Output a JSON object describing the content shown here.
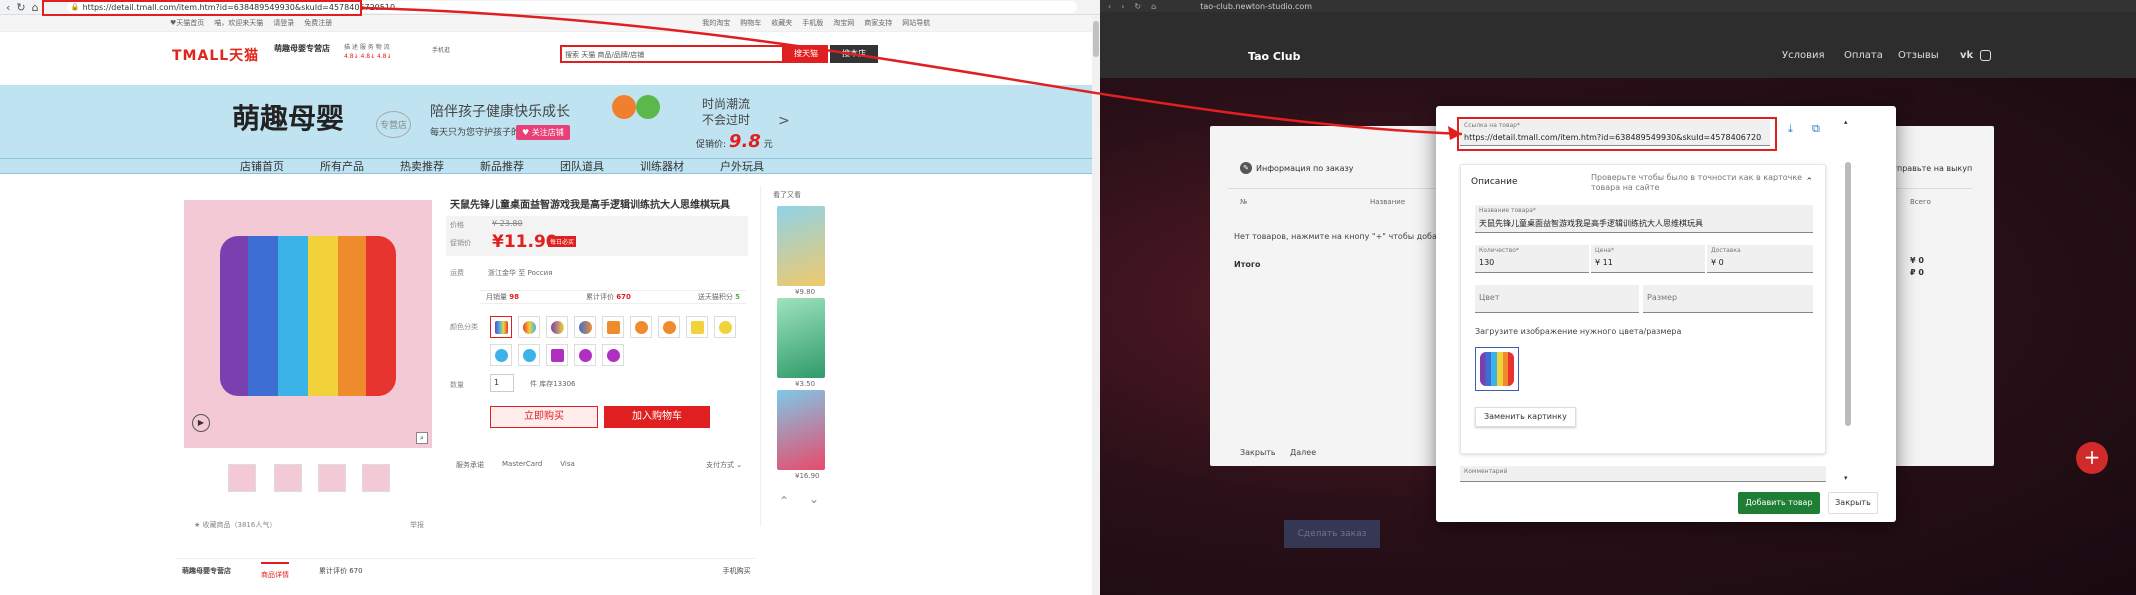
{
  "left": {
    "url": "https://detail.tmall.com/item.htm?id=638489549930&skuId=4578406720510",
    "topbar": {
      "links": [
        "♥天猫首页",
        "喵，欢迎来天猫",
        "请登录",
        "免费注册"
      ],
      "right_links": [
        "我的淘宝",
        "购物车",
        "收藏夹",
        "手机版",
        "淘宝网",
        "商家支持",
        "网站导航"
      ]
    },
    "header": {
      "logo": "TMALL天猫",
      "shop_name": "萌趣母婴专营店",
      "ratings_head": "描 述  服 务  物 流",
      "ratings_vals": "4.8↓  4.8↓  4.8↓",
      "mobile_label": "手机逛",
      "search_placeholder": "搜索 天猫 商品/品牌/店铺",
      "search_tmall_btn": "搜天猫",
      "search_shop_btn": "搜本店"
    },
    "banner": {
      "shop_title": "萌趣母婴",
      "shop_sub": "专营店",
      "slogan": "陪伴孩子健康快乐成长",
      "sub_slogan": "每天只为您守护孩子的健康",
      "follow_btn": "♥ 关注店铺",
      "trend1": "时尚潮流",
      "trend2": "不会过时",
      "promo_label": "促销价:",
      "promo_price": "9.8",
      "promo_unit": "元",
      "arrow": ">"
    },
    "nav": [
      "店铺首页",
      "所有产品",
      "热卖推荐",
      "新品推荐",
      "团队道具",
      "训练器材",
      "户外玩具"
    ],
    "product": {
      "title": "天鼠先锋儿童桌面益智游戏我是高手逻辑训练抗大人思维棋玩具",
      "price_label": "价格",
      "orig_price": "¥ 23.80",
      "promo_label": "促销价",
      "promo_price": "¥11.90",
      "promo_tag": "每日必买",
      "ship_label": "运费",
      "ship_value": "浙江金华  至 Россия",
      "monthly_label": "月销量",
      "monthly_value": "98",
      "reviews_label": "累计评价",
      "reviews_value": "670",
      "points_label": "送天猫积分",
      "points_value": "5",
      "color_label": "颜色分类",
      "qty_label": "数量",
      "qty_value": "1",
      "stock": "件   库存13306",
      "buy_now": "立即购买",
      "add_cart": "加入购物车",
      "pay_label": "服务承诺",
      "pay_methods": [
        "MasterCard",
        "Visa"
      ],
      "installment": "支付方式 ⌄",
      "favorite": "★ 收藏商品（3816人气）",
      "report": "举报"
    },
    "side": {
      "heading": "看了又看",
      "prices": [
        "¥9.80",
        "¥3.50",
        "¥16.90"
      ]
    },
    "bottom": {
      "shop": "萌趣母婴专营店",
      "tab_active": "商品详情",
      "tab_reviews": "累计评价  670",
      "phone": "手机购买"
    }
  },
  "right": {
    "url": "tao-club.newton-studio.com",
    "brand": "Tao Club",
    "nav": [
      "Условия",
      "Оплата",
      "Отзывы"
    ],
    "card": {
      "step1": "Информация по заказу",
      "step4": "Отправьте на выкуп",
      "col_no": "№",
      "col_name": "Название",
      "col_total": "Всего",
      "empty": "Нет товаров, нажмите на кнопу \"+\" чтобы добавить",
      "total_label": "Итого",
      "amt1": "¥ 0",
      "amt2": "₽ 0",
      "btn_close": "Закрыть",
      "btn_next": "Далее"
    },
    "make_order": "Сделать заказ",
    "modal": {
      "link_label": "Ссылка на товар*",
      "link_value": "https://detail.tmall.com/item.htm?id=638489549930&skuId=4578406720510",
      "section_title": "Описание",
      "section_desc": "Проверьте чтобы было в точности как в карточке товара на сайте",
      "name_label": "Название товара*",
      "name_value": "天鼠先锋儿童桌面益智游戏我是高手逻辑训练抗大人思维棋玩具",
      "qty_label": "Количество*",
      "qty_value": "130",
      "price_label": "Цена*",
      "price_value": "¥ 11",
      "delivery_label": "Доставка",
      "delivery_value": "¥ 0",
      "color_placeholder": "Цвет",
      "size_placeholder": "Размер",
      "upload_label": "Загрузите изображение нужного цвета/размера",
      "replace_btn": "Заменить картинку",
      "comment_label": "Комментарий",
      "add_btn": "Добавить товар",
      "close_btn": "Закрыть"
    }
  },
  "colors": {
    "tmall_red": "#e02020",
    "banner_blue": "#bfe3f1",
    "green": "#1e7e34",
    "fab_red": "#d12a2a"
  }
}
